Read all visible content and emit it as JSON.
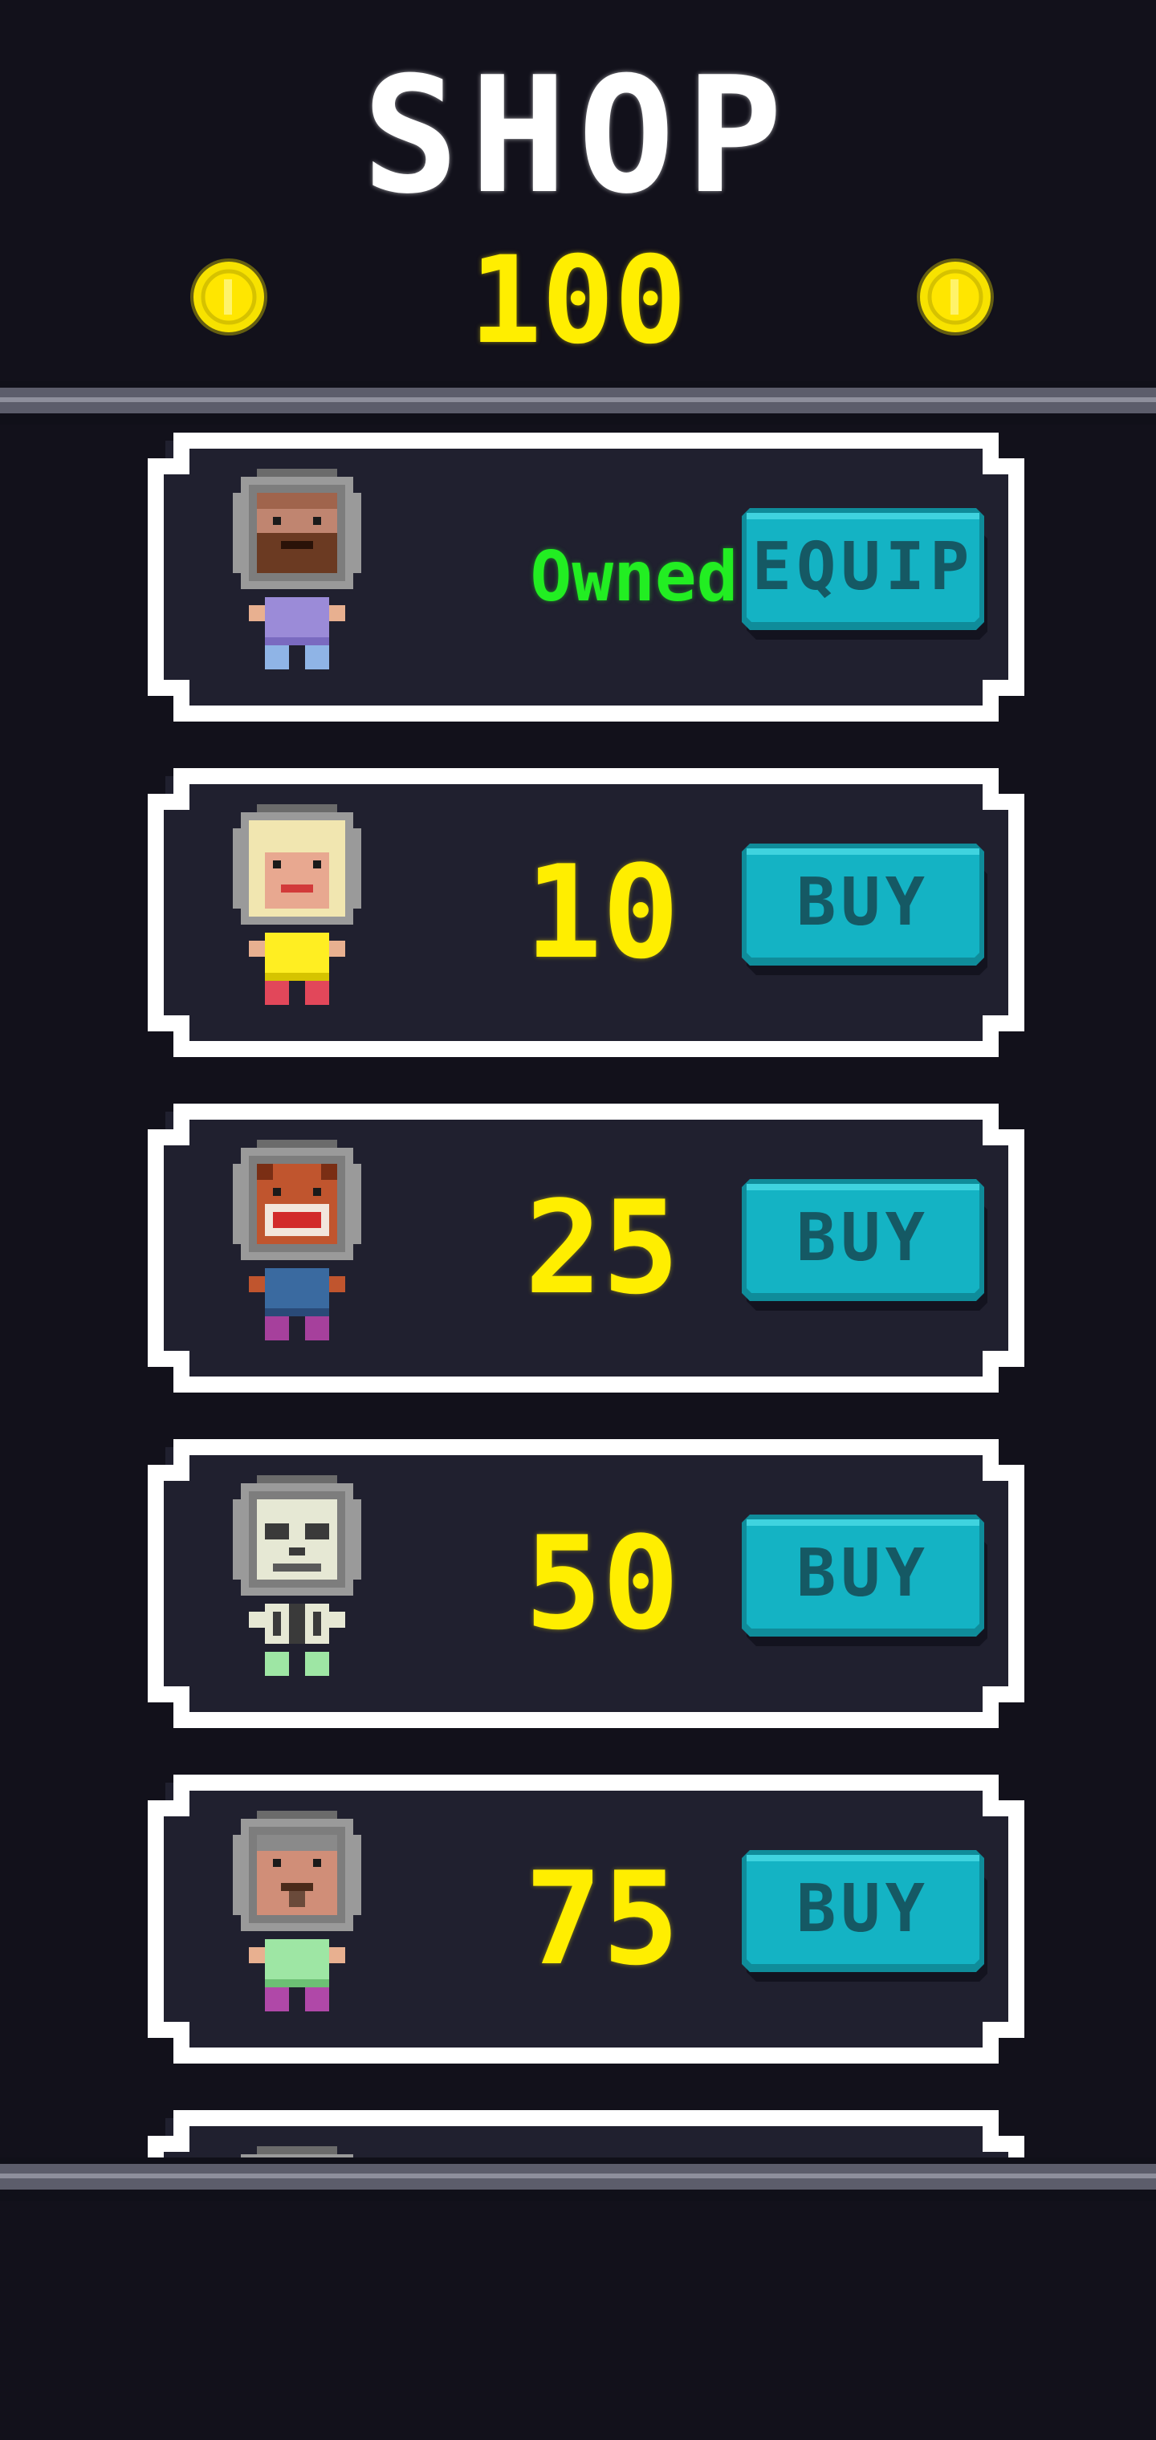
{
  "header": {
    "title": "SHOP",
    "coins": "100",
    "coin_icon": "coin-icon",
    "coin_color": "#ffee00"
  },
  "items": [
    {
      "character": "bearded-astronaut",
      "status": "Owned",
      "price": "",
      "button_label": "EQUIP"
    },
    {
      "character": "blonde-astronaut",
      "status": "",
      "price": "10",
      "button_label": "BUY"
    },
    {
      "character": "fox-astronaut",
      "status": "",
      "price": "25",
      "button_label": "BUY"
    },
    {
      "character": "skeleton-astronaut",
      "status": "",
      "price": "50",
      "button_label": "BUY"
    },
    {
      "character": "old-man-astronaut",
      "status": "",
      "price": "75",
      "button_label": "BUY"
    },
    {
      "character": "partially-visible-astronaut",
      "status": "",
      "price": "",
      "button_label": ""
    }
  ],
  "colors": {
    "background": "#12111b",
    "card_fill": "#20202f",
    "card_border": "#ffffff",
    "owned_text": "#22ee22",
    "price_text": "#ffee00",
    "button_fill": "#14b3c4",
    "button_text": "#155964"
  }
}
